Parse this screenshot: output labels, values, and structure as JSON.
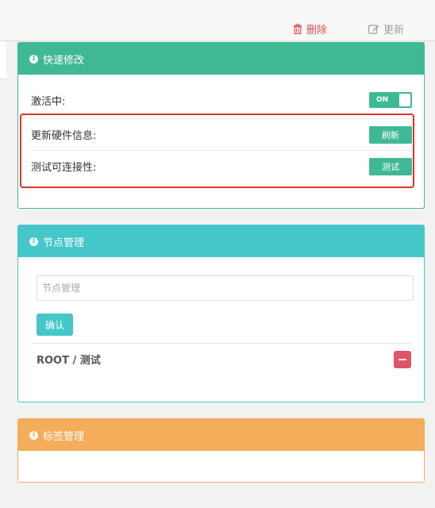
{
  "toolbar": {
    "delete_label": "删除",
    "update_label": "更新",
    "delete_icon": "trash-icon",
    "update_icon": "edit-icon"
  },
  "quick_edit": {
    "title": "快速修改",
    "active_label": "激活中:",
    "active_toggle": "ON",
    "refresh_label": "更新硬件信息:",
    "refresh_button": "刷新",
    "test_label": "测试可连接性:",
    "test_button": "测试"
  },
  "node_manage": {
    "title": "节点管理",
    "input_placeholder": "节点管理",
    "input_value": "",
    "confirm_button": "确认",
    "node_path": "ROOT / 测试"
  },
  "tag_manage": {
    "title": "标签管理"
  },
  "colors": {
    "green": "#3fb995",
    "teal": "#45c7c9",
    "orange": "#f4ad5a",
    "red": "#d9534f",
    "highlight_border": "#d9342b"
  }
}
